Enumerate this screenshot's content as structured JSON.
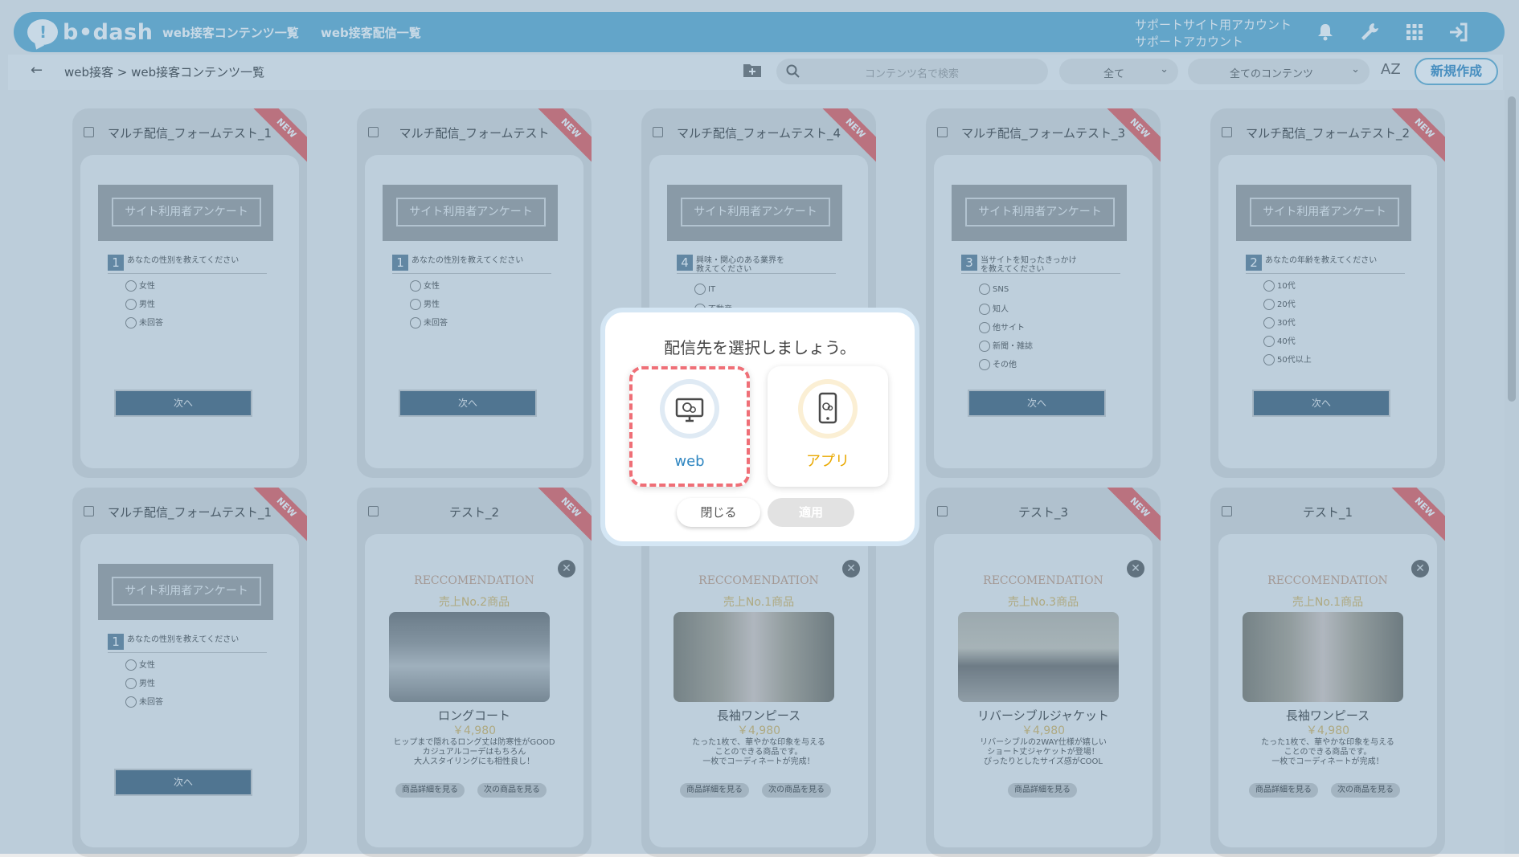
{
  "header": {
    "logo": "b•dash",
    "nav": [
      "web接客コンテンツ一覧",
      "web接客配信一覧"
    ],
    "account_line1": "サポートサイト用アカウント",
    "account_line2": "サポートアカウント",
    "icons": [
      "bell-icon",
      "wrench-icon",
      "grid-icon",
      "logout-icon"
    ]
  },
  "subbar": {
    "back": "←",
    "breadcrumb": "web接客 > web接客コンテンツ一覧",
    "search_placeholder": "コンテンツ名で検索",
    "filter1": "全て",
    "filter2": "全てのコンテンツ",
    "sort": "AZ",
    "new_button": "新規作成"
  },
  "ribbon": "NEW",
  "survey": {
    "banner": "サイト利用者アンケート",
    "next": "次へ"
  },
  "cards_row1": [
    {
      "title": "マルチ配信_フォームテスト_1",
      "qnum": "1",
      "question": "あなたの性別を教えてください",
      "options": [
        "女性",
        "男性",
        "未回答"
      ]
    },
    {
      "title": "マルチ配信_フォームテスト",
      "qnum": "1",
      "question": "あなたの性別を教えてください",
      "options": [
        "女性",
        "男性",
        "未回答"
      ]
    },
    {
      "title": "マルチ配信_フォームテスト_4",
      "qnum": "4",
      "question": "興味・関心のある業界を教えてください",
      "options": [
        "IT",
        "不動産"
      ]
    },
    {
      "title": "マルチ配信_フォームテスト_3",
      "qnum": "3",
      "question": "当サイトを知ったきっかけを教えてください",
      "options": [
        "SNS",
        "知人",
        "他サイト",
        "新聞・雑誌",
        "その他"
      ]
    },
    {
      "title": "マルチ配信_フォームテスト_2",
      "qnum": "2",
      "question": "あなたの年齢を教えてください",
      "options": [
        "10代",
        "20代",
        "30代",
        "40代",
        "50代以上"
      ]
    }
  ],
  "cards_row2": {
    "survey": {
      "title": "マルチ配信_フォームテスト_1",
      "qnum": "1",
      "question": "あなたの性別を教えてください",
      "options": [
        "女性",
        "男性",
        "未回答"
      ]
    },
    "recc_heading": "RECCOMENDATION",
    "detail_button": "商品詳細を見る",
    "next_button": "次の商品を見る",
    "close": "✕",
    "products": [
      {
        "title": "テスト_2",
        "rank": "売上No.2商品",
        "name": "ロングコート",
        "price": "￥4,980",
        "desc": [
          "ヒップまで隠れるロング丈は防寒性がGOOD",
          "カジュアルコーデはもちろん",
          "大人スタイリングにも相性良し！"
        ]
      },
      {
        "title": "",
        "rank": "売上No.1商品",
        "name": "長袖ワンピース",
        "price": "￥4,980",
        "desc": [
          "たった1枚で、華やかな印象を与える",
          "ことのできる商品です。",
          "一枚でコーディネートが完成！"
        ]
      },
      {
        "title": "テスト_3",
        "rank": "売上No.3商品",
        "name": "リバーシブルジャケット",
        "price": "￥4,980",
        "desc": [
          "リバーシブルの2WAY仕様が嬉しい",
          "ショート丈ジャケットが登場！",
          "ぴったりとしたサイズ感がCOOL"
        ]
      },
      {
        "title": "テスト_1",
        "rank": "売上No.1商品",
        "name": "長袖ワンピース",
        "price": "￥4,980",
        "desc": [
          "たった1枚で、華やかな印象を与える",
          "ことのできる商品です。",
          "一枚でコーディネートが完成！"
        ]
      }
    ]
  },
  "modal": {
    "title": "配信先を選択しましょう。",
    "web_label": "web",
    "app_label": "アプリ",
    "close_button": "閉じる",
    "apply_button": "適用"
  },
  "colors": {
    "brand": "#5dacd1",
    "web": "#2f86c1",
    "app": "#e9a800",
    "dashed": "#ef6f77"
  }
}
